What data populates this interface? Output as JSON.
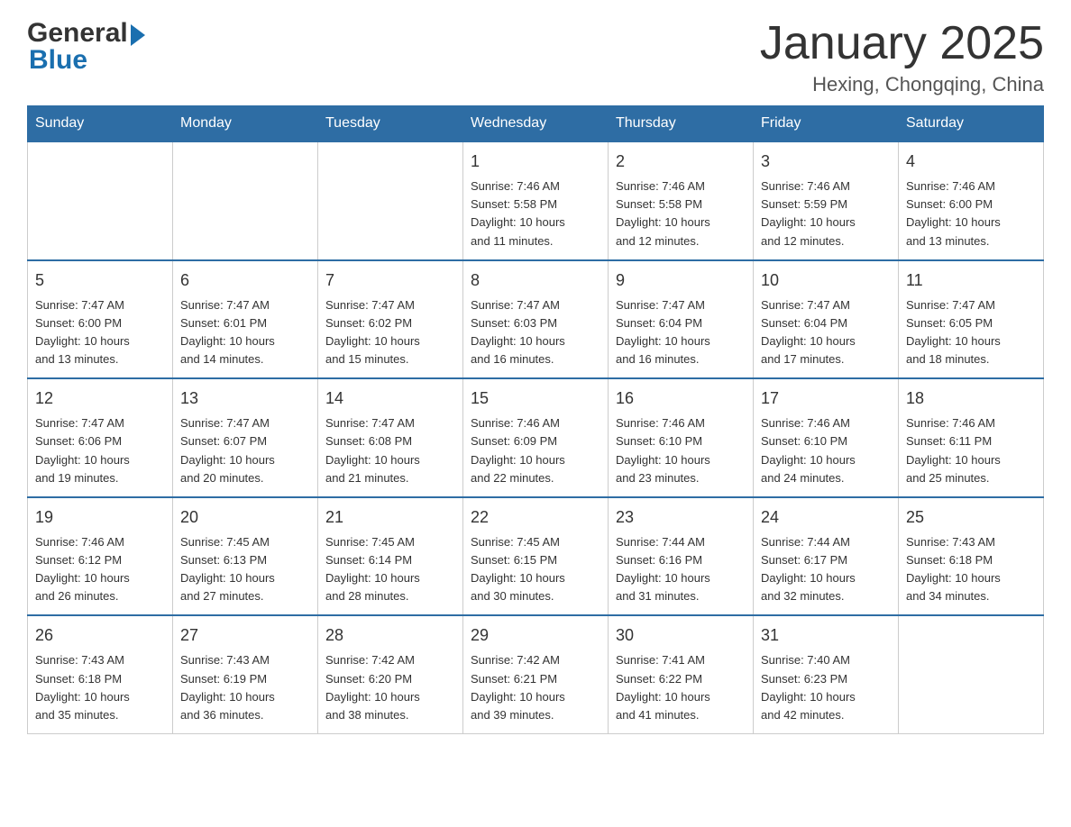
{
  "header": {
    "logo_general": "General",
    "logo_blue": "Blue",
    "title": "January 2025",
    "location": "Hexing, Chongqing, China"
  },
  "calendar": {
    "days_of_week": [
      "Sunday",
      "Monday",
      "Tuesday",
      "Wednesday",
      "Thursday",
      "Friday",
      "Saturday"
    ],
    "weeks": [
      [
        {
          "day": "",
          "info": ""
        },
        {
          "day": "",
          "info": ""
        },
        {
          "day": "",
          "info": ""
        },
        {
          "day": "1",
          "info": "Sunrise: 7:46 AM\nSunset: 5:58 PM\nDaylight: 10 hours\nand 11 minutes."
        },
        {
          "day": "2",
          "info": "Sunrise: 7:46 AM\nSunset: 5:58 PM\nDaylight: 10 hours\nand 12 minutes."
        },
        {
          "day": "3",
          "info": "Sunrise: 7:46 AM\nSunset: 5:59 PM\nDaylight: 10 hours\nand 12 minutes."
        },
        {
          "day": "4",
          "info": "Sunrise: 7:46 AM\nSunset: 6:00 PM\nDaylight: 10 hours\nand 13 minutes."
        }
      ],
      [
        {
          "day": "5",
          "info": "Sunrise: 7:47 AM\nSunset: 6:00 PM\nDaylight: 10 hours\nand 13 minutes."
        },
        {
          "day": "6",
          "info": "Sunrise: 7:47 AM\nSunset: 6:01 PM\nDaylight: 10 hours\nand 14 minutes."
        },
        {
          "day": "7",
          "info": "Sunrise: 7:47 AM\nSunset: 6:02 PM\nDaylight: 10 hours\nand 15 minutes."
        },
        {
          "day": "8",
          "info": "Sunrise: 7:47 AM\nSunset: 6:03 PM\nDaylight: 10 hours\nand 16 minutes."
        },
        {
          "day": "9",
          "info": "Sunrise: 7:47 AM\nSunset: 6:04 PM\nDaylight: 10 hours\nand 16 minutes."
        },
        {
          "day": "10",
          "info": "Sunrise: 7:47 AM\nSunset: 6:04 PM\nDaylight: 10 hours\nand 17 minutes."
        },
        {
          "day": "11",
          "info": "Sunrise: 7:47 AM\nSunset: 6:05 PM\nDaylight: 10 hours\nand 18 minutes."
        }
      ],
      [
        {
          "day": "12",
          "info": "Sunrise: 7:47 AM\nSunset: 6:06 PM\nDaylight: 10 hours\nand 19 minutes."
        },
        {
          "day": "13",
          "info": "Sunrise: 7:47 AM\nSunset: 6:07 PM\nDaylight: 10 hours\nand 20 minutes."
        },
        {
          "day": "14",
          "info": "Sunrise: 7:47 AM\nSunset: 6:08 PM\nDaylight: 10 hours\nand 21 minutes."
        },
        {
          "day": "15",
          "info": "Sunrise: 7:46 AM\nSunset: 6:09 PM\nDaylight: 10 hours\nand 22 minutes."
        },
        {
          "day": "16",
          "info": "Sunrise: 7:46 AM\nSunset: 6:10 PM\nDaylight: 10 hours\nand 23 minutes."
        },
        {
          "day": "17",
          "info": "Sunrise: 7:46 AM\nSunset: 6:10 PM\nDaylight: 10 hours\nand 24 minutes."
        },
        {
          "day": "18",
          "info": "Sunrise: 7:46 AM\nSunset: 6:11 PM\nDaylight: 10 hours\nand 25 minutes."
        }
      ],
      [
        {
          "day": "19",
          "info": "Sunrise: 7:46 AM\nSunset: 6:12 PM\nDaylight: 10 hours\nand 26 minutes."
        },
        {
          "day": "20",
          "info": "Sunrise: 7:45 AM\nSunset: 6:13 PM\nDaylight: 10 hours\nand 27 minutes."
        },
        {
          "day": "21",
          "info": "Sunrise: 7:45 AM\nSunset: 6:14 PM\nDaylight: 10 hours\nand 28 minutes."
        },
        {
          "day": "22",
          "info": "Sunrise: 7:45 AM\nSunset: 6:15 PM\nDaylight: 10 hours\nand 30 minutes."
        },
        {
          "day": "23",
          "info": "Sunrise: 7:44 AM\nSunset: 6:16 PM\nDaylight: 10 hours\nand 31 minutes."
        },
        {
          "day": "24",
          "info": "Sunrise: 7:44 AM\nSunset: 6:17 PM\nDaylight: 10 hours\nand 32 minutes."
        },
        {
          "day": "25",
          "info": "Sunrise: 7:43 AM\nSunset: 6:18 PM\nDaylight: 10 hours\nand 34 minutes."
        }
      ],
      [
        {
          "day": "26",
          "info": "Sunrise: 7:43 AM\nSunset: 6:18 PM\nDaylight: 10 hours\nand 35 minutes."
        },
        {
          "day": "27",
          "info": "Sunrise: 7:43 AM\nSunset: 6:19 PM\nDaylight: 10 hours\nand 36 minutes."
        },
        {
          "day": "28",
          "info": "Sunrise: 7:42 AM\nSunset: 6:20 PM\nDaylight: 10 hours\nand 38 minutes."
        },
        {
          "day": "29",
          "info": "Sunrise: 7:42 AM\nSunset: 6:21 PM\nDaylight: 10 hours\nand 39 minutes."
        },
        {
          "day": "30",
          "info": "Sunrise: 7:41 AM\nSunset: 6:22 PM\nDaylight: 10 hours\nand 41 minutes."
        },
        {
          "day": "31",
          "info": "Sunrise: 7:40 AM\nSunset: 6:23 PM\nDaylight: 10 hours\nand 42 minutes."
        },
        {
          "day": "",
          "info": ""
        }
      ]
    ]
  }
}
